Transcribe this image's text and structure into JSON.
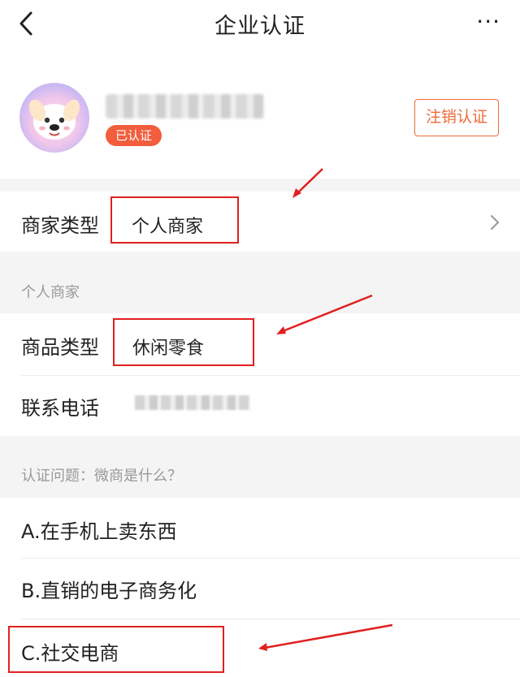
{
  "header": {
    "title": "企业认证",
    "more_label": "···"
  },
  "profile": {
    "verified_badge": "已认证",
    "cancel_button": "注销认证"
  },
  "merchant_type": {
    "label": "商家类型",
    "value": "个人商家"
  },
  "section_personal": "个人商家",
  "goods_type": {
    "label": "商品类型",
    "value": "休闲零食"
  },
  "contact_phone": {
    "label": "联系电话"
  },
  "question": "认证问题：微商是什么？",
  "options": [
    "A.在手机上卖东西",
    "B.直销的电子商务化",
    "C.社交电商"
  ],
  "colors": {
    "accent": "#f06a3a",
    "badge": "#f25d3c",
    "highlight": "#e02020",
    "gap": "#f4f4f4"
  }
}
